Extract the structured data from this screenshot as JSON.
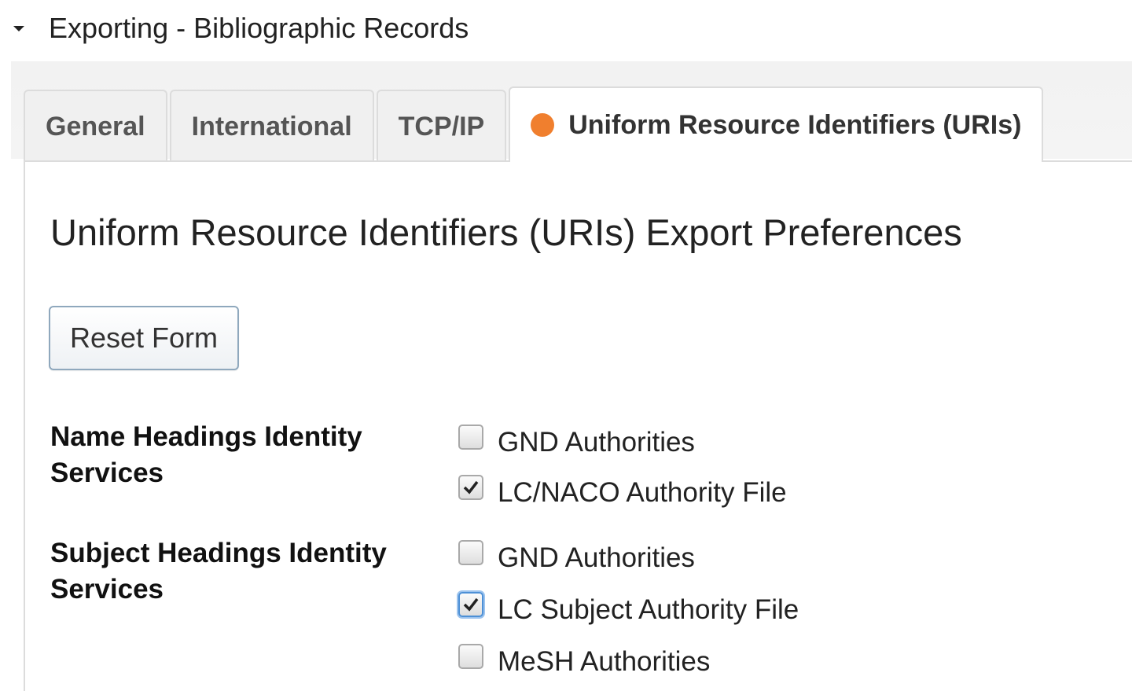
{
  "section": {
    "title": "Exporting - Bibliographic Records"
  },
  "tabs": [
    {
      "label": "General",
      "active": false
    },
    {
      "label": "International",
      "active": false
    },
    {
      "label": "TCP/IP",
      "active": false
    },
    {
      "label": "Uniform Resource Identifiers (URIs)",
      "active": true,
      "indicator_color": "#f07f2e"
    }
  ],
  "panel": {
    "heading": "Uniform Resource Identifiers (URIs) Export Preferences",
    "reset_label": "Reset Form"
  },
  "name_headings": {
    "label_line1": "Name Headings Identity",
    "label_line2": "Services",
    "options": [
      {
        "label": "GND Authorities",
        "checked": false
      },
      {
        "label": "LC/NACO Authority File",
        "checked": true
      }
    ]
  },
  "subject_headings": {
    "label_line1": "Subject Headings Identity",
    "label_line2": "Services",
    "options": [
      {
        "label": "GND Authorities",
        "checked": false
      },
      {
        "label": "LC Subject Authority File",
        "checked": true
      },
      {
        "label": "MeSH Authorities",
        "checked": false
      }
    ]
  }
}
